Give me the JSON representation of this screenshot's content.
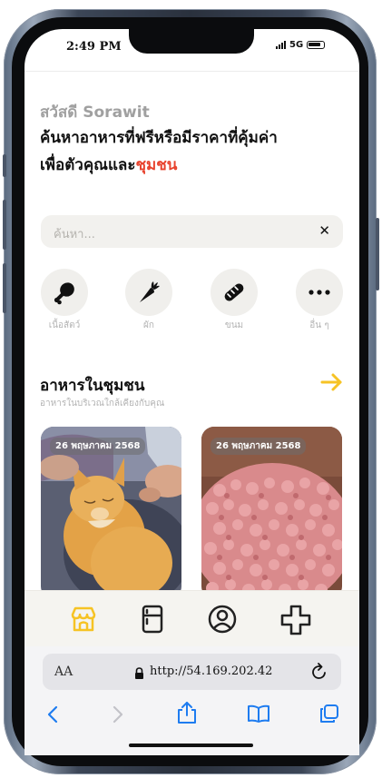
{
  "status": {
    "time": "2:49 PM",
    "network": "5G"
  },
  "greeting": "สวัสดี Sorawit",
  "headline": {
    "line1": "ค้นหาอาหารที่ฟรีหรือมีราคาที่คุ้มค่า",
    "line2_prefix": "เพื่อตัวคุณและ",
    "line2_accent": "ชุมชน"
  },
  "search": {
    "placeholder": "ค้นหา..."
  },
  "categories": [
    {
      "label": "เนื้อสัตว์",
      "icon": "drumstick-icon"
    },
    {
      "label": "ผัก",
      "icon": "carrot-icon"
    },
    {
      "label": "ขนม",
      "icon": "bread-icon"
    },
    {
      "label": "อื่น ๆ",
      "icon": "more-dots-icon"
    }
  ],
  "section": {
    "title": "อาหารในชุมชน",
    "subtitle": "อาหารในบริเวณใกล้เคียงกับคุณ"
  },
  "cards": [
    {
      "date": "26 พฤษภาคม 2568",
      "image": "orange-cat-photo"
    },
    {
      "date": "26 พฤษภาคม 2568",
      "image": "minced-meat-photo"
    }
  ],
  "tabbar": [
    "store-icon",
    "fridge-icon",
    "profile-icon",
    "plus-icon"
  ],
  "browser": {
    "text_size": "AA",
    "url": "http://54.169.202.42"
  },
  "colors": {
    "accent": "#e8432e",
    "highlight": "#f6c324"
  }
}
